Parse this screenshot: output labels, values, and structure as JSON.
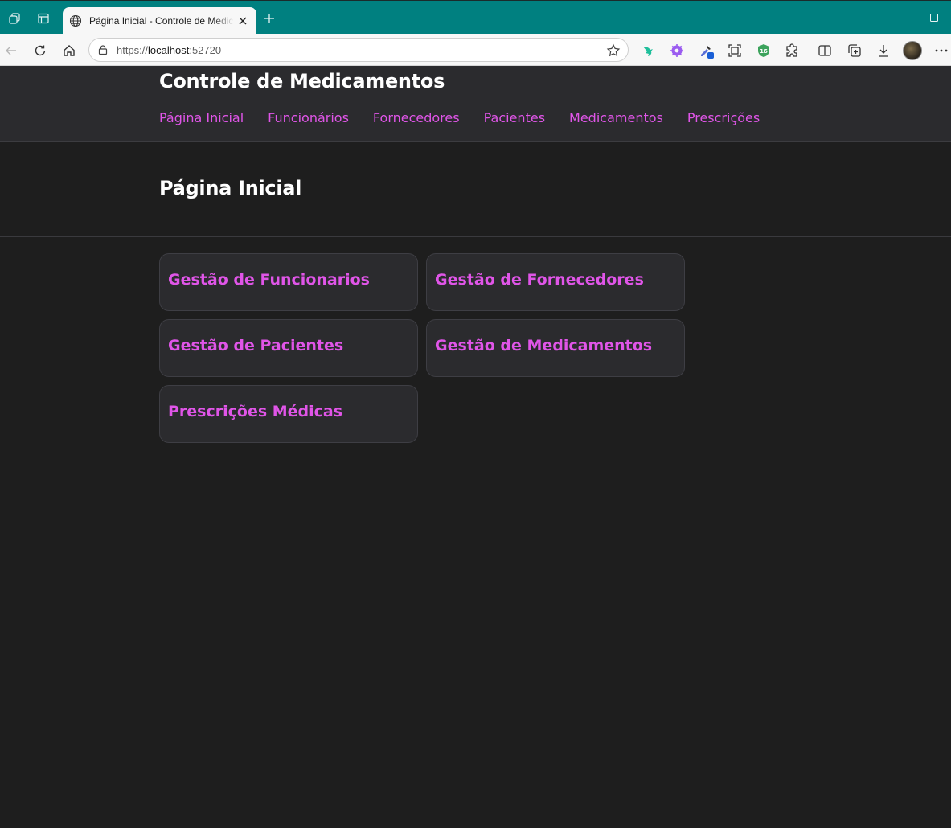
{
  "browser": {
    "tab_title": "Página Inicial - Controle de Medicamentos",
    "url_scheme": "https://",
    "url_host": "localhost",
    "url_port": ":52720",
    "icons": [
      "workspaces-icon",
      "tab-actions-icon",
      "globe-icon",
      "close-icon",
      "new-tab-icon",
      "minimize-icon",
      "maximize-icon",
      "back-icon",
      "refresh-icon",
      "home-icon",
      "lock-icon",
      "favorite-star-icon",
      "extension-icons",
      "split-screen-icon",
      "collections-icon",
      "downloads-icon",
      "more-icon"
    ]
  },
  "site": {
    "brand": "Controle de Medicamentos",
    "nav": [
      {
        "label": "Página Inicial"
      },
      {
        "label": "Funcionários"
      },
      {
        "label": "Fornecedores"
      },
      {
        "label": "Pacientes"
      },
      {
        "label": "Medicamentos"
      },
      {
        "label": "Prescrições"
      }
    ]
  },
  "main": {
    "title": "Página Inicial",
    "cards": [
      {
        "label": "Gestão de Funcionarios"
      },
      {
        "label": "Gestão de Fornecedores"
      },
      {
        "label": "Gestão de Pacientes"
      },
      {
        "label": "Gestão de Medicamentos"
      },
      {
        "label": "Prescrições Médicas"
      }
    ]
  },
  "colors": {
    "titlebar": "#008080",
    "page_background": "#1e1e1e",
    "header_background": "#2b2b2e",
    "accent_link": "#e055e8"
  }
}
